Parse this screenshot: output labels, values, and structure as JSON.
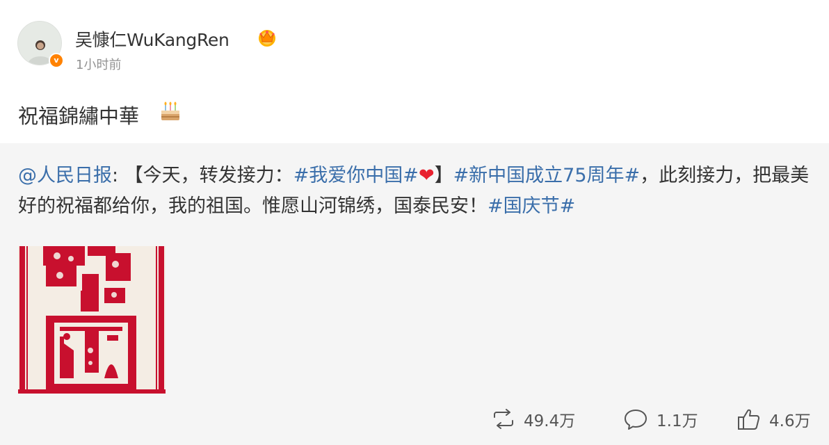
{
  "author": {
    "name": "吴慷仁WuKangRen",
    "verified_mark": "v",
    "timestamp": "1小时前",
    "avatar_icon": "avatar",
    "vip_icon": "crown-badge-icon"
  },
  "post": {
    "text": "祝福錦繡中華",
    "emoji_icon": "birthday-cake-icon"
  },
  "repost": {
    "mention": "@人民日报",
    "colon": ": ",
    "text_1": "【今天，转发接力：",
    "tag_1": "#我爱你中国#",
    "heart": "❤",
    "text_2": "】",
    "tag_2": "#新中国成立75周年#",
    "text_3": "，此刻接力，把最美好的祝福都给你，我的祖国。惟愿山河锦绣，国泰民安！",
    "tag_3": "#国庆节#",
    "image_alt": "red papercut artwork"
  },
  "actions": {
    "repost_count": "49.4万",
    "comment_count": "1.1万",
    "like_count": "4.6万"
  },
  "colors": {
    "link": "#3a6eaa",
    "badge": "#ff8200",
    "papercut_red": "#c8102e",
    "repost_bg": "#f5f5f5"
  }
}
